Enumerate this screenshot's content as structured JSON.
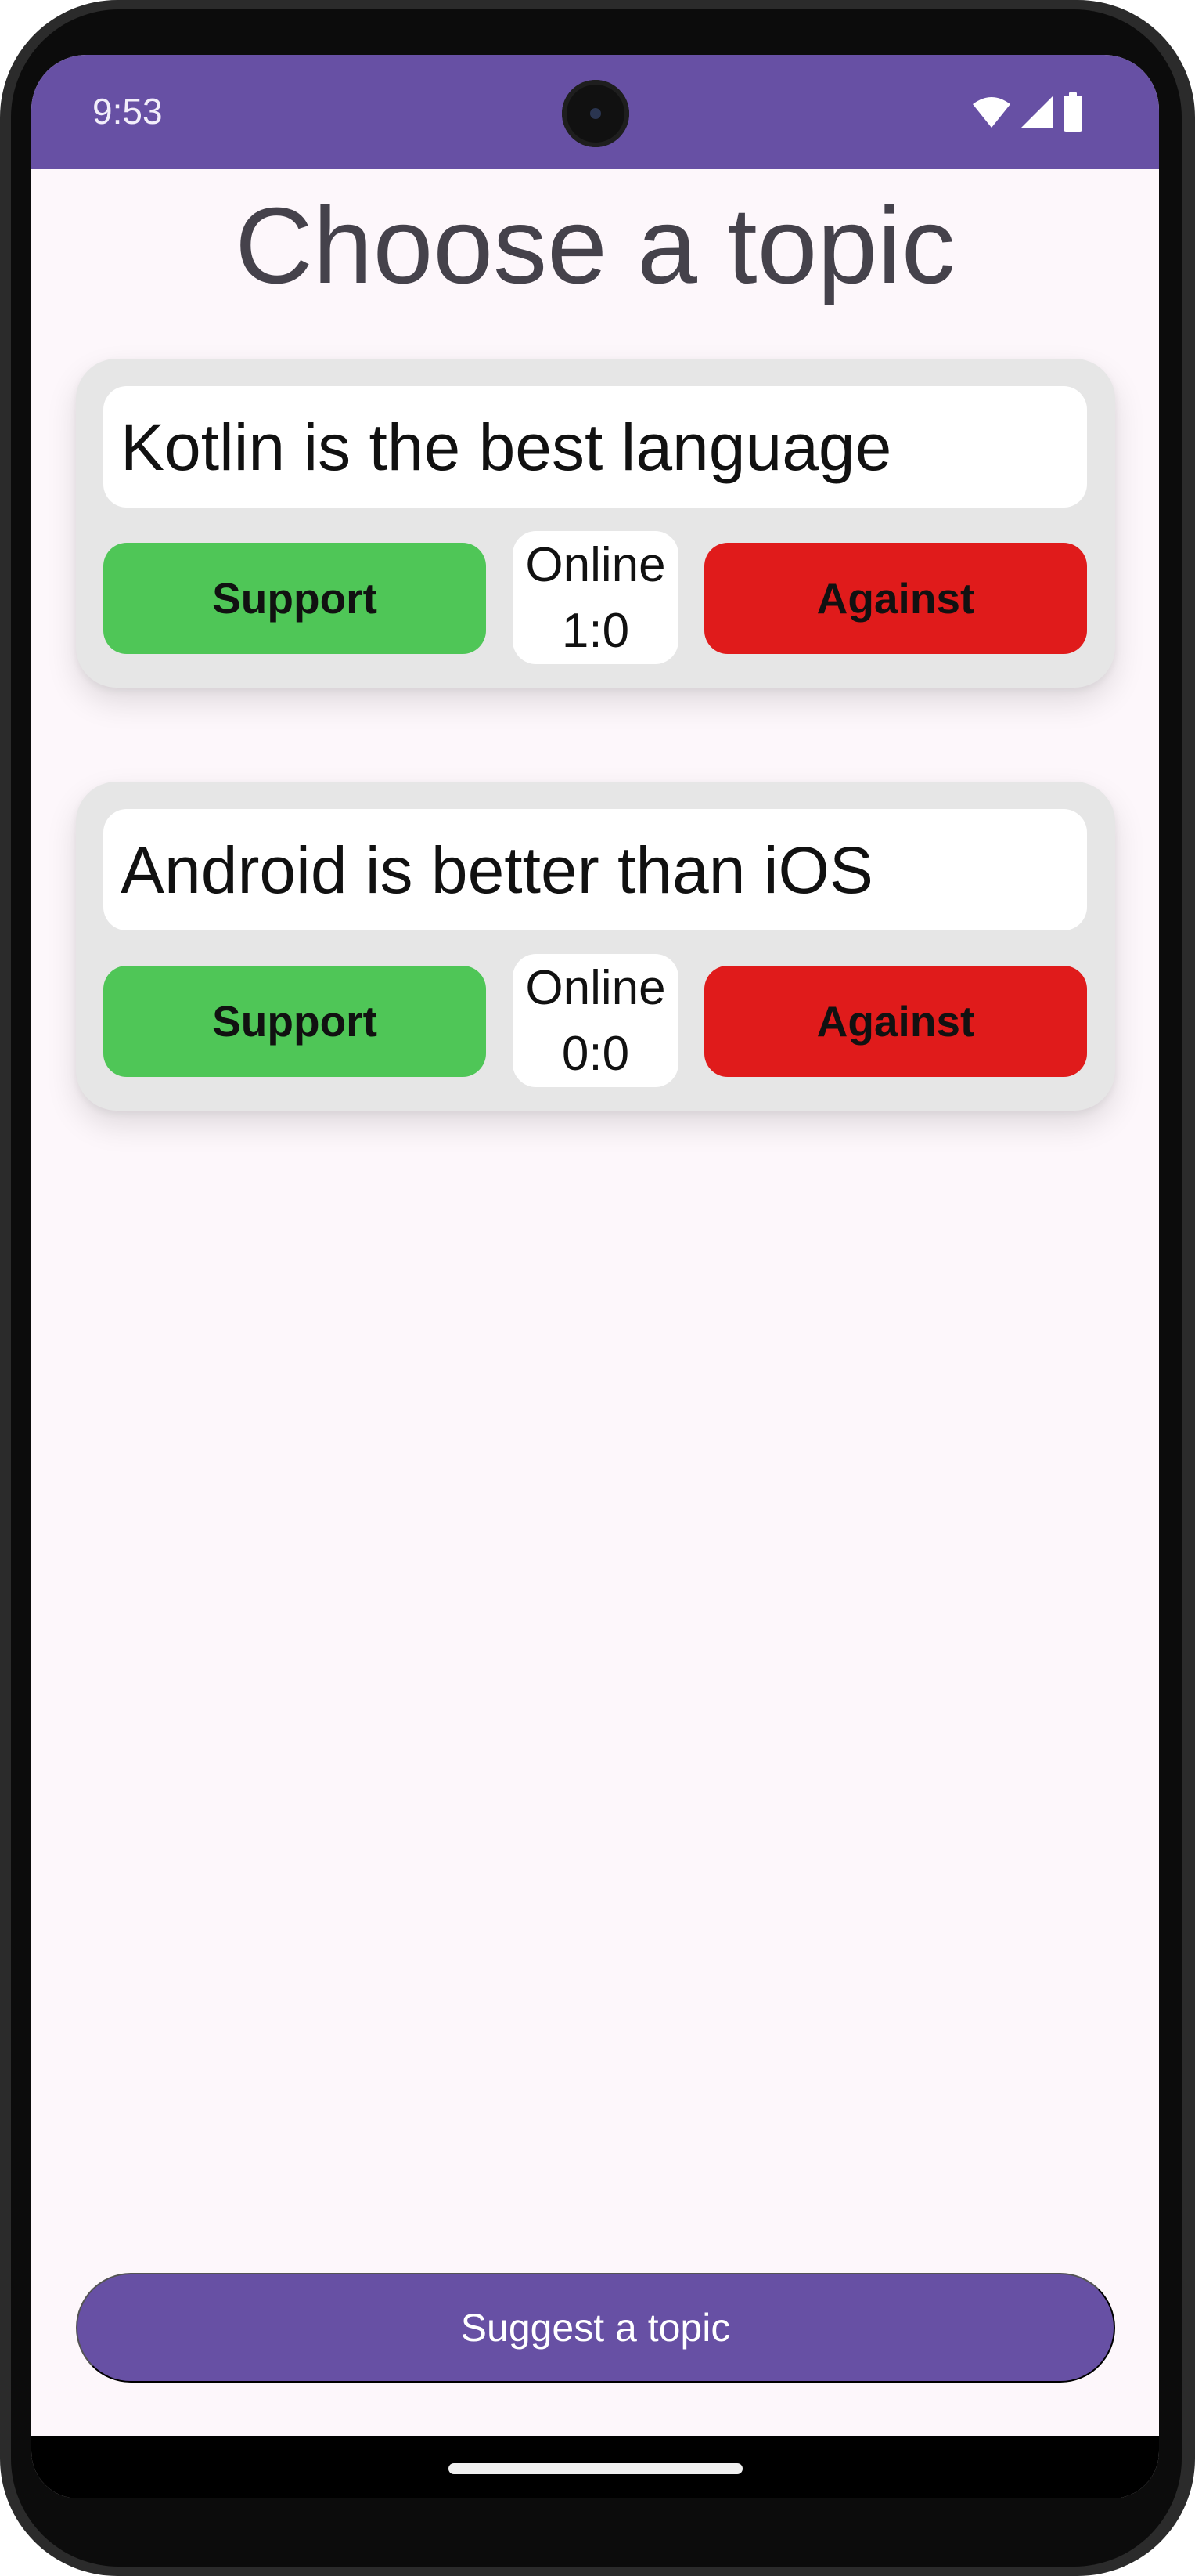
{
  "status_bar": {
    "time": "9:53",
    "icons": [
      "wifi-icon",
      "cellular-signal-icon",
      "battery-icon"
    ],
    "color": "#6750a4"
  },
  "page": {
    "title": "Choose a topic"
  },
  "topics": [
    {
      "title": "Kotlin is the best language",
      "support_label": "Support",
      "against_label": "Against",
      "online_label": "Online",
      "score": "1:0"
    },
    {
      "title": "Android is better than iOS",
      "support_label": "Support",
      "against_label": "Against",
      "online_label": "Online",
      "score": "0:0"
    }
  ],
  "footer": {
    "suggest_label": "Suggest a topic"
  },
  "colors": {
    "accent": "#6750a4",
    "support": "#4fc657",
    "against": "#e01b1b",
    "card": "#e6e6e6",
    "background": "#fdf7fb"
  }
}
